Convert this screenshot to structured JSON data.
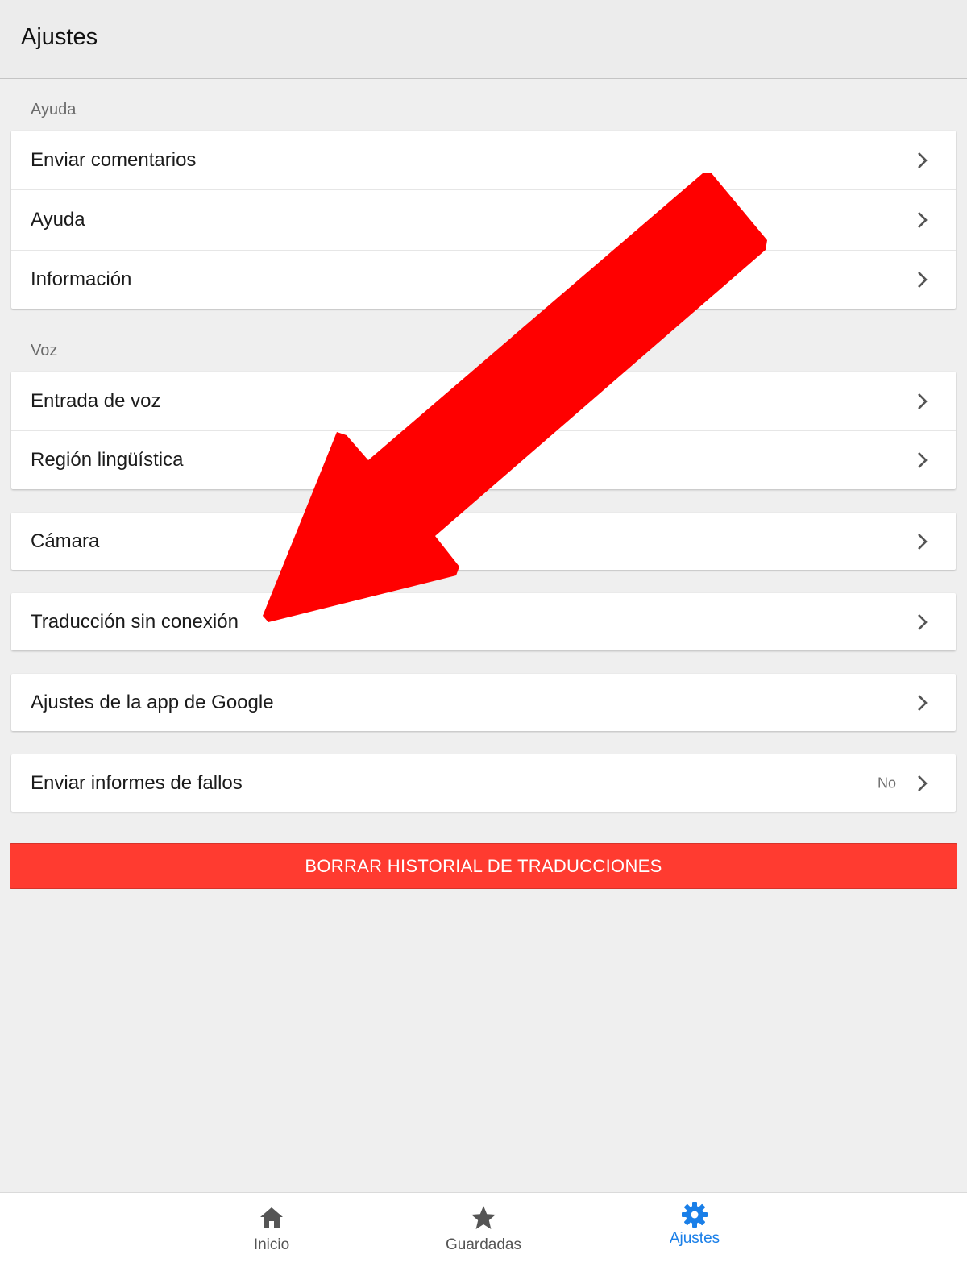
{
  "header": {
    "title": "Ajustes"
  },
  "sections": {
    "ayuda": {
      "label": "Ayuda",
      "items": [
        "Enviar comentarios",
        "Ayuda",
        "Información"
      ]
    },
    "voz": {
      "label": "Voz",
      "items": [
        "Entrada de voz",
        "Región lingüística"
      ]
    }
  },
  "items": {
    "camara": "Cámara",
    "offline": "Traducción sin conexión",
    "google_app": "Ajustes de la app de Google",
    "crash_reports": {
      "label": "Enviar informes de fallos",
      "value": "No"
    }
  },
  "clear_history_button": "BORRAR HISTORIAL DE TRADUCCIONES",
  "tabbar": {
    "tabs": [
      "Inicio",
      "Guardadas",
      "Ajustes"
    ],
    "active": "Ajustes"
  },
  "colors": {
    "accent": "#1a7fe8",
    "danger": "#ff3b30",
    "annotation_arrow": "#ff0000"
  }
}
